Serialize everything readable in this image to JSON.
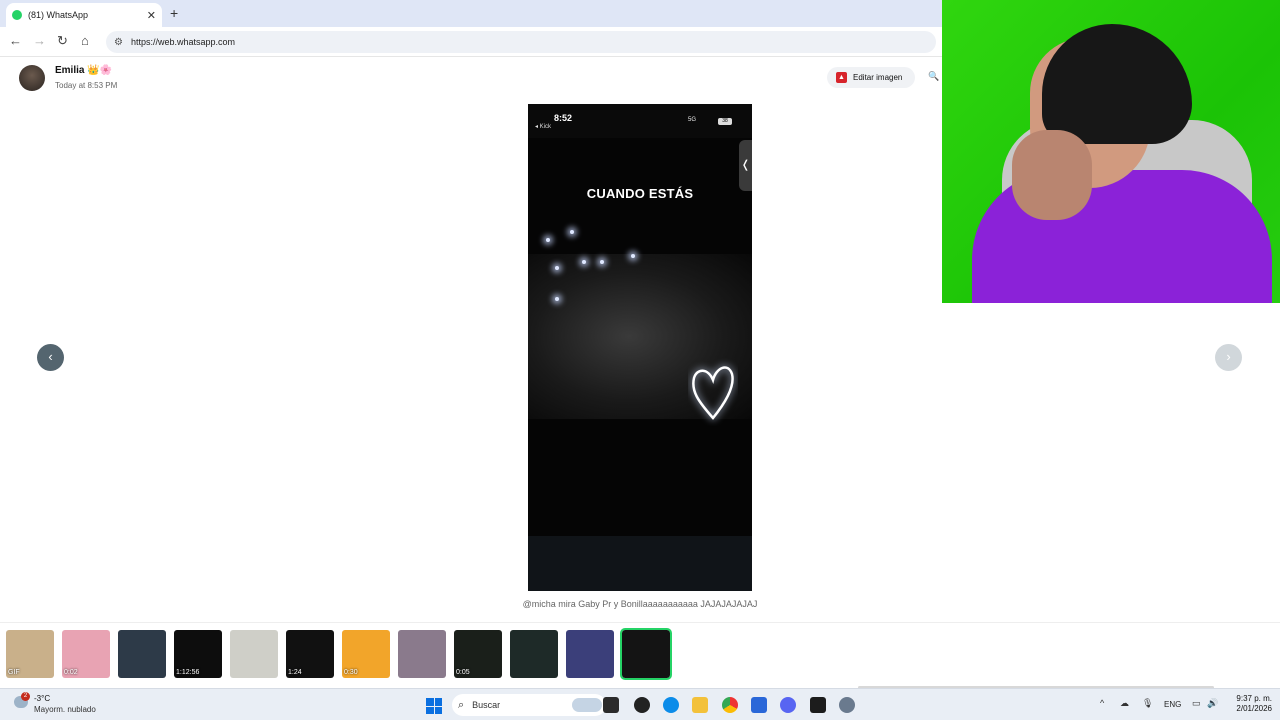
{
  "browser": {
    "tab_title": "(81) WhatsApp",
    "tab_close": "✕",
    "new_tab": "+",
    "url": "https://web.whatsapp.com"
  },
  "viewer": {
    "sender_name": "Emilia",
    "sender_emoji": "👑🌸",
    "timestamp": "Today at 8:53 PM",
    "edit_button_label": "Editar imagen",
    "caption": "@micha mira Gaby Pr y Bonillaaaaaaaaaaa JAJAJAJAJAJ",
    "prev_arrow": "‹",
    "next_arrow": "›"
  },
  "phone_screenshot": {
    "status_time": "8:52",
    "back_label": "◂ Kick",
    "signal_text": "5G",
    "battery_text": "38",
    "overlay_text": "CUANDO ESTÁS",
    "handle_glyph": "❬"
  },
  "thumbnails": [
    {
      "badge": "GIF",
      "color": "#c9b08a"
    },
    {
      "badge": "0:02",
      "color": "#e8a3b3"
    },
    {
      "badge": "",
      "color": "#2d3a48"
    },
    {
      "badge": "1:12:56",
      "color": "#0d0d0d"
    },
    {
      "badge": "",
      "color": "#cfcfc8"
    },
    {
      "badge": "1:24",
      "color": "#111111"
    },
    {
      "badge": "0:30",
      "color": "#f2a52a"
    },
    {
      "badge": "",
      "color": "#8a7a8c"
    },
    {
      "badge": "0:05",
      "color": "#1a1f1a"
    },
    {
      "badge": "",
      "color": "#1e2a28"
    },
    {
      "badge": "",
      "color": "#3b3f7a"
    },
    {
      "badge": "",
      "color": "#141414"
    }
  ],
  "taskbar": {
    "weather_badge": "2",
    "temperature": "-3°C",
    "weather_desc": "Mayorm. nublado",
    "search_label": "Buscar",
    "language": "ENG",
    "time": "9:37 p. m.",
    "date": "2/01/2026"
  },
  "colors": {
    "whatsapp_green": "#25d366",
    "nav_dark": "#54656f",
    "tab_bar": "#dfe6f6"
  }
}
